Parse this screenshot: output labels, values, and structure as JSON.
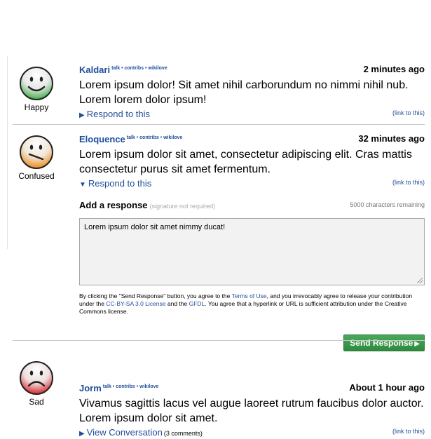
{
  "comments": [
    {
      "user": "Kaldari",
      "user_links": "talk • contribs • wikilove",
      "time": "2 minutes ago",
      "text": "Lorem ipsum dolor!  Sit amet nihil carborundum no nimmi nihil nub. Lorem lorem dolor ipsum!",
      "mood": "Happy",
      "respond_arrow": "▶",
      "respond_label": "Respond to this",
      "permalink": "(link to this)",
      "face_color": "#3fae4a"
    },
    {
      "user": "Eloquence",
      "user_links": "talk • contribs • wikilove",
      "time": "32 minutes ago",
      "text": "Lorem ipsum dolor sit amet, consectetur adipiscing elit. Cras mattis consectetur purus sit amet fermentum.",
      "mood": "Confused",
      "respond_arrow": "▼",
      "respond_label": "Respond to this",
      "permalink": "(link to this)",
      "face_color": "#ee8a1a"
    },
    {
      "user": "Jorm",
      "user_links": "talk • contribs • wikilove",
      "time": "About 1 hour ago",
      "text": "Vivamus sagittis lacus vel augue laoreet rutrum faucibus dolor auctor. Lorem ipsum dolor sit amet.",
      "mood": "Sad",
      "respond_arrow": "▶",
      "respond_label": "View Conversation",
      "comment_count": "(3 comments)",
      "permalink": "(link to this)",
      "face_color": "#d9262b"
    }
  ],
  "response": {
    "title": "Add a response",
    "note": "(signature not required)",
    "remaining": "5000 characters remaining",
    "value": "Lorem ipsum dolor sit amet nimmy ducat!",
    "terms_1": "By clicking the \"Send Response\" button, you agree to the ",
    "terms_link_1": "Terms of Use",
    "terms_2": ", and you irrevocably agree to release your contribution under the ",
    "terms_link_2": "CC-BY-SA 3.0 License",
    "terms_3": " and the ",
    "terms_link_3": "GFDL",
    "terms_4": ". You agree that a hyperlink or URL is sufficient attribution under the Creative Commons license.",
    "send_label": "Send Response",
    "send_arrow": "▶"
  },
  "colors": {
    "link": "#1f4e9a",
    "send_button": "#2f8a3f"
  }
}
